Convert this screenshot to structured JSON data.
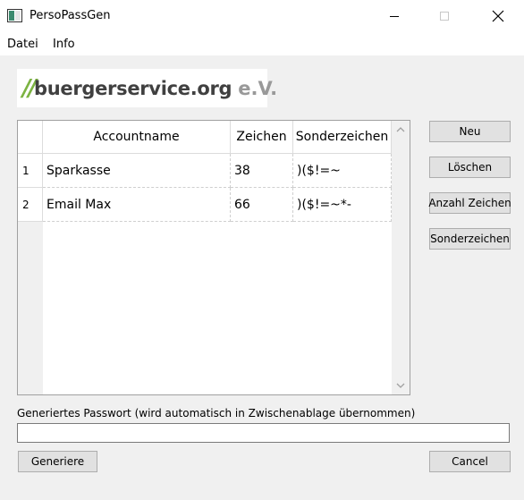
{
  "window": {
    "title": "PersoPassGen"
  },
  "menu": {
    "items": [
      "Datei",
      "Info"
    ]
  },
  "logo": {
    "slashes": "//",
    "name": "buergerservice.org",
    "suffix": "e.V."
  },
  "table": {
    "columns": [
      "Accountname",
      "Zeichen",
      "Sonderzeichen"
    ],
    "rows": [
      {
        "num": "1",
        "accountname": "Sparkasse",
        "zeichen": "38",
        "sonderzeichen": ")($!=~"
      },
      {
        "num": "2",
        "accountname": "Email Max",
        "zeichen": "66",
        "sonderzeichen": ")($!=~*-"
      }
    ]
  },
  "buttons": {
    "neu": "Neu",
    "loeschen": "Löschen",
    "anzahl_zeichen": "Anzahl Zeichen",
    "sonderzeichen": "Sonderzeichen",
    "generiere": "Generiere",
    "cancel": "Cancel"
  },
  "password": {
    "label": "Generiertes Passwort (wird automatisch in Zwischenablage übernommen)",
    "value": ""
  },
  "colors": {
    "logo_green": "#7cb342",
    "logo_dark": "#404040",
    "logo_grey": "#999999",
    "button_bg": "#e1e1e1",
    "window_bg": "#f0f0f0"
  }
}
